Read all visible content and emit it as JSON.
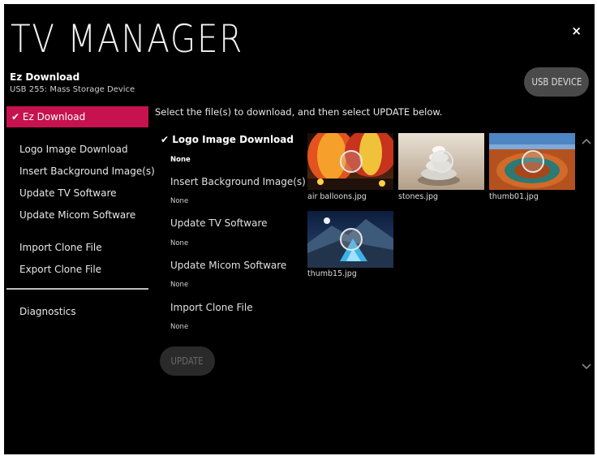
{
  "header": {
    "title": "TV MANAGER",
    "close_label": "×",
    "section": "Ez Download",
    "device": "USB 255: Mass Storage Device",
    "usb_button": "USB DEVICE"
  },
  "sidebar": {
    "selected": "✔ Ez Download",
    "items": [
      {
        "label": "Logo Image Download"
      },
      {
        "label": "Insert Background Image(s)"
      },
      {
        "label": "Update TV Software"
      },
      {
        "label": "Update Micom Software"
      },
      {
        "label": "Import Clone File"
      },
      {
        "label": "Export Clone File"
      },
      {
        "label": "Diagnostics"
      }
    ]
  },
  "main": {
    "instruction": "Select the file(s) to download, and then select UPDATE below.",
    "options": [
      {
        "label": "✔ Logo Image Download",
        "value": "None"
      },
      {
        "label": "Insert Background Image(s)",
        "value": "None"
      },
      {
        "label": "Update TV Software",
        "value": "None"
      },
      {
        "label": "Update Micom Software",
        "value": "None"
      },
      {
        "label": "Import Clone File",
        "value": "None"
      }
    ],
    "update_button": "UPDATE",
    "files": [
      {
        "name": "air balloons.jpg"
      },
      {
        "name": "stones.jpg"
      },
      {
        "name": "thumb01.jpg"
      },
      {
        "name": "thumb15.jpg"
      }
    ],
    "scroll_up": "⌃",
    "scroll_down": "⌄"
  },
  "colors": {
    "accent": "#c6134f",
    "background": "#000000"
  }
}
